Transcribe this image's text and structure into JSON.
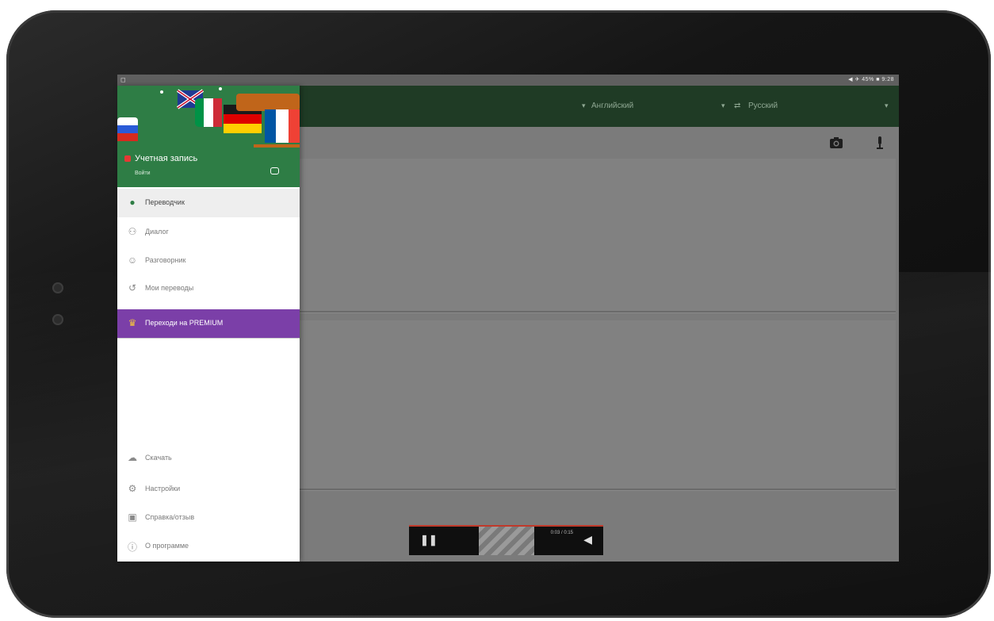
{
  "status_bar": {
    "left_icon": "notification-icon",
    "right_text": "◀ ✈ 45% ■ 9:28"
  },
  "toolbar": {
    "source_language": "Английский",
    "target_language": "Русский",
    "swap_symbol": "⇄",
    "caret": "▾",
    "camera_icon": "camera-icon",
    "mic_icon": "microphone-icon",
    "color": "#1f3b25"
  },
  "drawer": {
    "header_color": "#2e7d45",
    "account_title": "Учетная запись",
    "account_subtitle": "Войти",
    "menu_items": [
      {
        "label": "Переводчик",
        "icon": "translate-icon",
        "glyph": "●",
        "active": true
      },
      {
        "label": "Диалог",
        "icon": "dialog-icon",
        "glyph": "⚇"
      },
      {
        "label": "Разговорник",
        "icon": "phrasebook-icon",
        "glyph": "☺"
      },
      {
        "label": "Мои переводы",
        "icon": "history-icon",
        "glyph": "↺"
      },
      {
        "label": "Переходи на PREMIUM",
        "icon": "crown-icon",
        "glyph": "♛",
        "premium": true,
        "color": "#7b3fa8"
      }
    ],
    "bottom_items": [
      {
        "label": "Скачать",
        "icon": "download-icon",
        "glyph": "☁"
      },
      {
        "label": "Настройки",
        "icon": "settings-icon",
        "glyph": "⚙"
      },
      {
        "label": "Справка/отзыв",
        "icon": "help-icon",
        "glyph": "▣"
      },
      {
        "label": "О программе",
        "icon": "about-icon",
        "glyph": "ⓘ"
      }
    ]
  },
  "media_overlay": {
    "pause_icon": "pause-icon",
    "pause_glyph": "❚❚",
    "time_text": "0:03 / 0:15",
    "volume_icon": "volume-icon",
    "volume_glyph": "◀"
  }
}
